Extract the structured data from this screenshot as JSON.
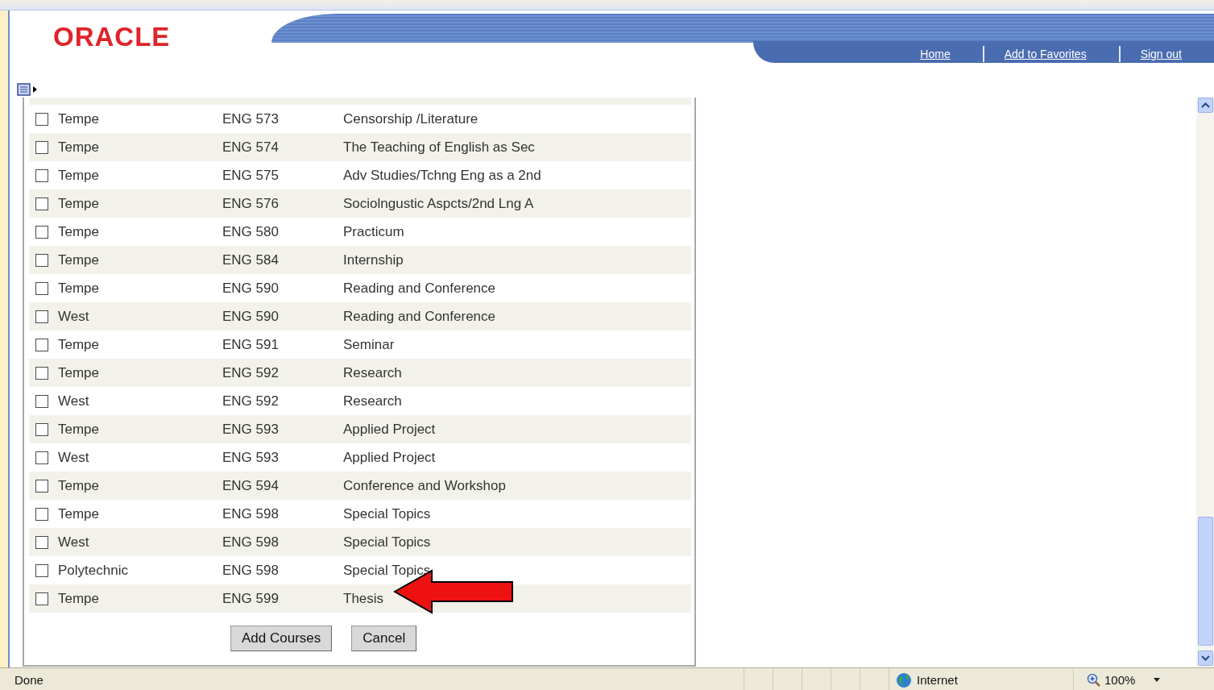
{
  "header": {
    "logo": "ORACLE",
    "links": [
      {
        "label": "Home"
      },
      {
        "label": "Add to Favorites"
      },
      {
        "label": "Sign out"
      }
    ]
  },
  "courses": [
    {
      "checked": false,
      "campus": "Tempe",
      "code": "ENG 573",
      "title": "Censorship /Literature"
    },
    {
      "checked": false,
      "campus": "Tempe",
      "code": "ENG 574",
      "title": "The Teaching of English as Sec"
    },
    {
      "checked": false,
      "campus": "Tempe",
      "code": "ENG 575",
      "title": "Adv Studies/Tchng Eng as a 2nd"
    },
    {
      "checked": false,
      "campus": "Tempe",
      "code": "ENG 576",
      "title": "Sociolngustic Aspcts/2nd Lng A"
    },
    {
      "checked": false,
      "campus": "Tempe",
      "code": "ENG 580",
      "title": "Practicum"
    },
    {
      "checked": false,
      "campus": "Tempe",
      "code": "ENG 584",
      "title": "Internship"
    },
    {
      "checked": false,
      "campus": "Tempe",
      "code": "ENG 590",
      "title": "Reading and Conference"
    },
    {
      "checked": false,
      "campus": "West",
      "code": "ENG 590",
      "title": "Reading and Conference"
    },
    {
      "checked": false,
      "campus": "Tempe",
      "code": "ENG 591",
      "title": "Seminar"
    },
    {
      "checked": false,
      "campus": "Tempe",
      "code": "ENG 592",
      "title": "Research"
    },
    {
      "checked": false,
      "campus": "West",
      "code": "ENG 592",
      "title": "Research"
    },
    {
      "checked": false,
      "campus": "Tempe",
      "code": "ENG 593",
      "title": "Applied Project"
    },
    {
      "checked": false,
      "campus": "West",
      "code": "ENG 593",
      "title": "Applied Project"
    },
    {
      "checked": false,
      "campus": "Tempe",
      "code": "ENG 594",
      "title": "Conference and Workshop"
    },
    {
      "checked": false,
      "campus": "Tempe",
      "code": "ENG 598",
      "title": "Special Topics"
    },
    {
      "checked": false,
      "campus": "West",
      "code": "ENG 598",
      "title": "Special Topics"
    },
    {
      "checked": false,
      "campus": "Polytechnic",
      "code": "ENG 598",
      "title": "Special Topics"
    },
    {
      "checked": false,
      "campus": "Tempe",
      "code": "ENG 599",
      "title": "Thesis"
    }
  ],
  "buttons": [
    "Add Courses",
    "Cancel"
  ],
  "status_bar": {
    "text": "Done",
    "zone": "Internet",
    "zoom": "100%"
  }
}
